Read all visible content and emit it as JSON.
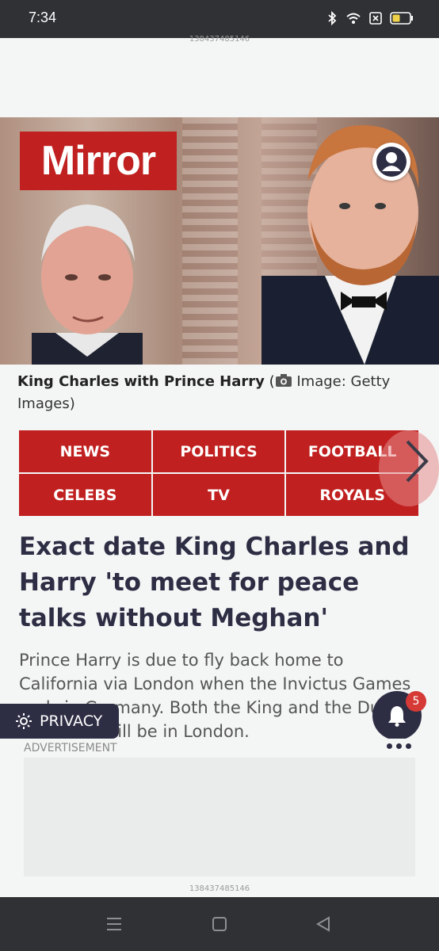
{
  "status_bar": {
    "time": "7:34"
  },
  "ad_ids": {
    "top": "138437485146",
    "bottom": "138437485146"
  },
  "brand": {
    "logo_text": "Mirror"
  },
  "hero": {
    "caption_who": "King Charles with Prince Harry",
    "caption_open": "(",
    "caption_source": "Image: Getty Images)"
  },
  "nav": {
    "items": [
      "NEWS",
      "POLITICS",
      "FOOTBALL",
      "CELEBS",
      "TV",
      "ROYALS"
    ]
  },
  "article": {
    "headline": "Exact date King Charles and Harry 'to meet for peace talks without Meghan'",
    "lede": "Prince Harry is due to fly back home to California via London when the Invictus Games ends in Germany. Both the King and the Duke of Sussex will be in London."
  },
  "privacy": {
    "label": "PRIVACY"
  },
  "notifications": {
    "count": "5"
  },
  "ad": {
    "label": "ADVERTISEMENT"
  },
  "colors": {
    "brand_red": "#c0201f",
    "navy": "#2d2e44"
  }
}
